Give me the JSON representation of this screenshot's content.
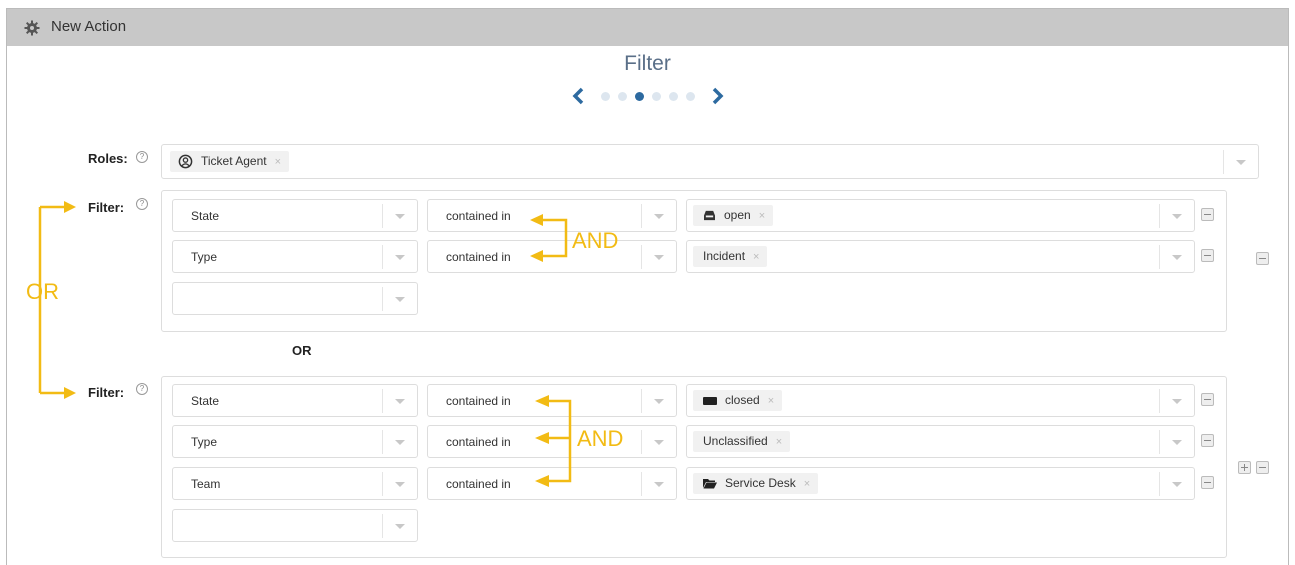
{
  "window": {
    "title": "New Action",
    "icon": "gear-icon"
  },
  "heading": "Filter",
  "pager": {
    "total": 6,
    "active": 2
  },
  "roles": {
    "label": "Roles:",
    "token": "Ticket Agent",
    "token_icon": "user-circle-icon"
  },
  "filter_label": "Filter:",
  "between_groups": "OR",
  "groups": [
    {
      "rows": [
        {
          "attribute": "State",
          "operator": "contained in",
          "value": "open",
          "value_icon": "inbox-icon"
        },
        {
          "attribute": "Type",
          "operator": "contained in",
          "value": "Incident",
          "value_icon": ""
        }
      ]
    },
    {
      "rows": [
        {
          "attribute": "State",
          "operator": "contained in",
          "value": "closed",
          "value_icon": "closed-icon"
        },
        {
          "attribute": "Type",
          "operator": "contained in",
          "value": "Unclassified",
          "value_icon": ""
        },
        {
          "attribute": "Team",
          "operator": "contained in",
          "value": "Service Desk",
          "value_icon": "folder-icon"
        }
      ]
    }
  ],
  "annotations": {
    "and_1": "AND",
    "and_2": "AND",
    "or": "OR",
    "color": "#f2bb14"
  }
}
